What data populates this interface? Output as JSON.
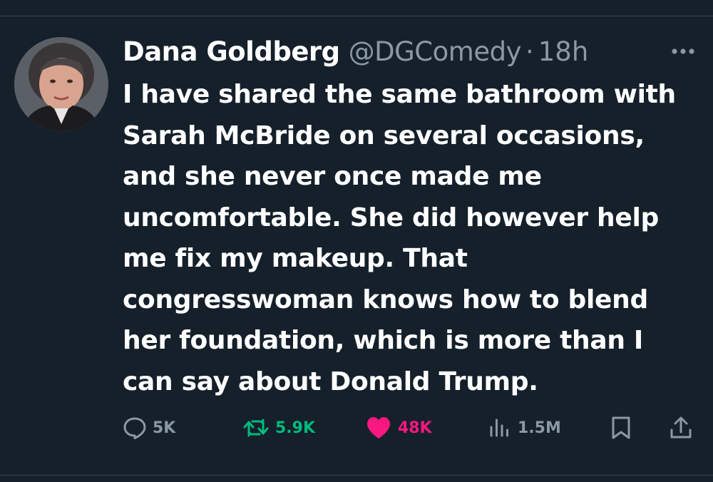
{
  "tweet": {
    "author": {
      "display_name": "Dana Goldberg",
      "handle": "@DGComedy",
      "separator": "·",
      "time": "18h"
    },
    "text": "I have shared the same bathroom with Sarah McBride on several occasions, and she never once made me uncomfortable. She did however help me fix my makeup. That congresswoman knows how to blend her foundation, which is more than I can say about Donald Trump.",
    "actions": {
      "reply": {
        "icon": "reply-icon",
        "count": "5K"
      },
      "retweet": {
        "icon": "retweet-icon",
        "count": "5.9K",
        "color": "#00ba7c"
      },
      "like": {
        "icon": "heart-icon",
        "count": "48K",
        "color": "#f91880"
      },
      "views": {
        "icon": "views-chart-icon",
        "count": "1.5M"
      },
      "bookmark": {
        "icon": "bookmark-icon"
      },
      "share": {
        "icon": "share-icon"
      }
    },
    "more_icon": "more-dots-icon"
  },
  "colors": {
    "background": "#15202b",
    "text": "#ffffff",
    "muted": "#8b98a5",
    "divider": "#38444d"
  }
}
